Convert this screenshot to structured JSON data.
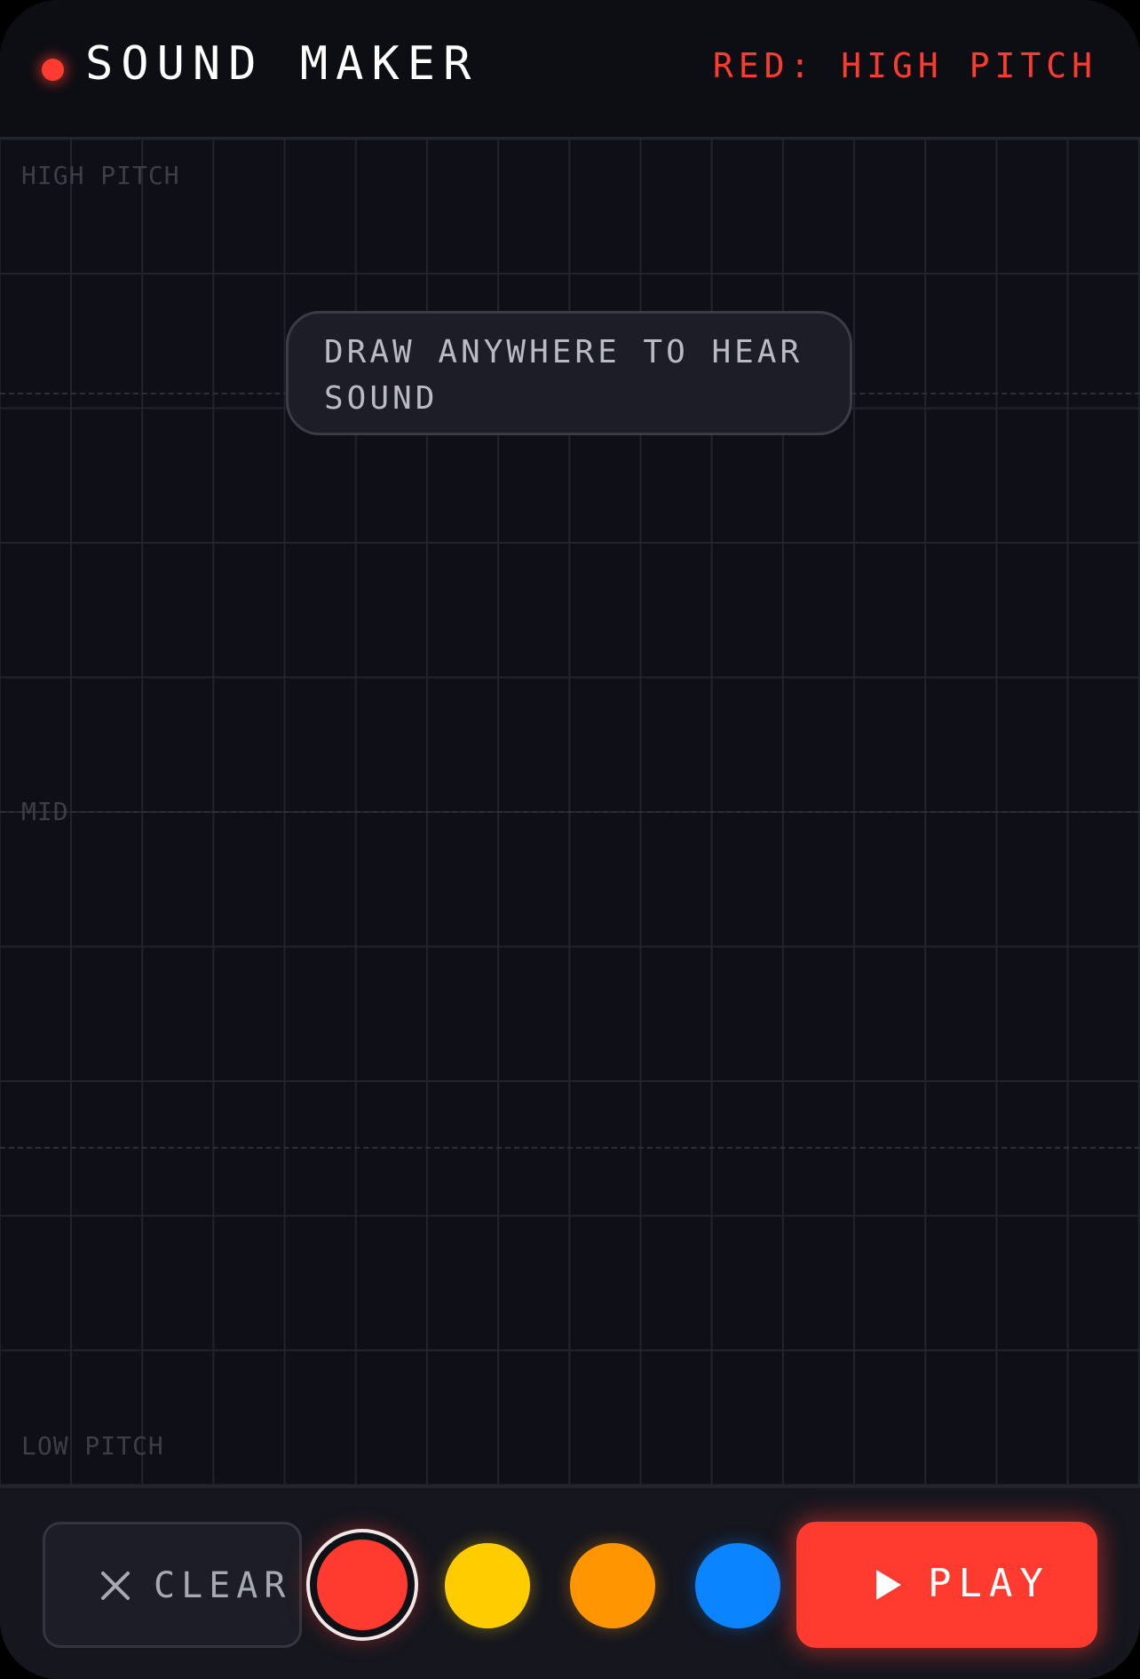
{
  "header": {
    "title": "SOUND MAKER",
    "mode_label": "RED: HIGH PITCH",
    "indicator_color": "#ff3b30"
  },
  "canvas": {
    "hint": "DRAW ANYWHERE TO HEAR SOUND",
    "axis_labels": {
      "high": "HIGH PITCH",
      "mid": "MID",
      "low": "LOW PITCH"
    },
    "grid": true
  },
  "footer": {
    "clear_label": "CLEAR",
    "clear_icon": "close-icon",
    "play_label": "PLAY",
    "play_icon": "play-icon",
    "colors": [
      {
        "name": "red",
        "hex": "#ff3b30",
        "selected": true
      },
      {
        "name": "yellow",
        "hex": "#ffcc00",
        "selected": false
      },
      {
        "name": "orange",
        "hex": "#ff9500",
        "selected": false
      },
      {
        "name": "blue",
        "hex": "#0a84ff",
        "selected": false
      }
    ]
  }
}
